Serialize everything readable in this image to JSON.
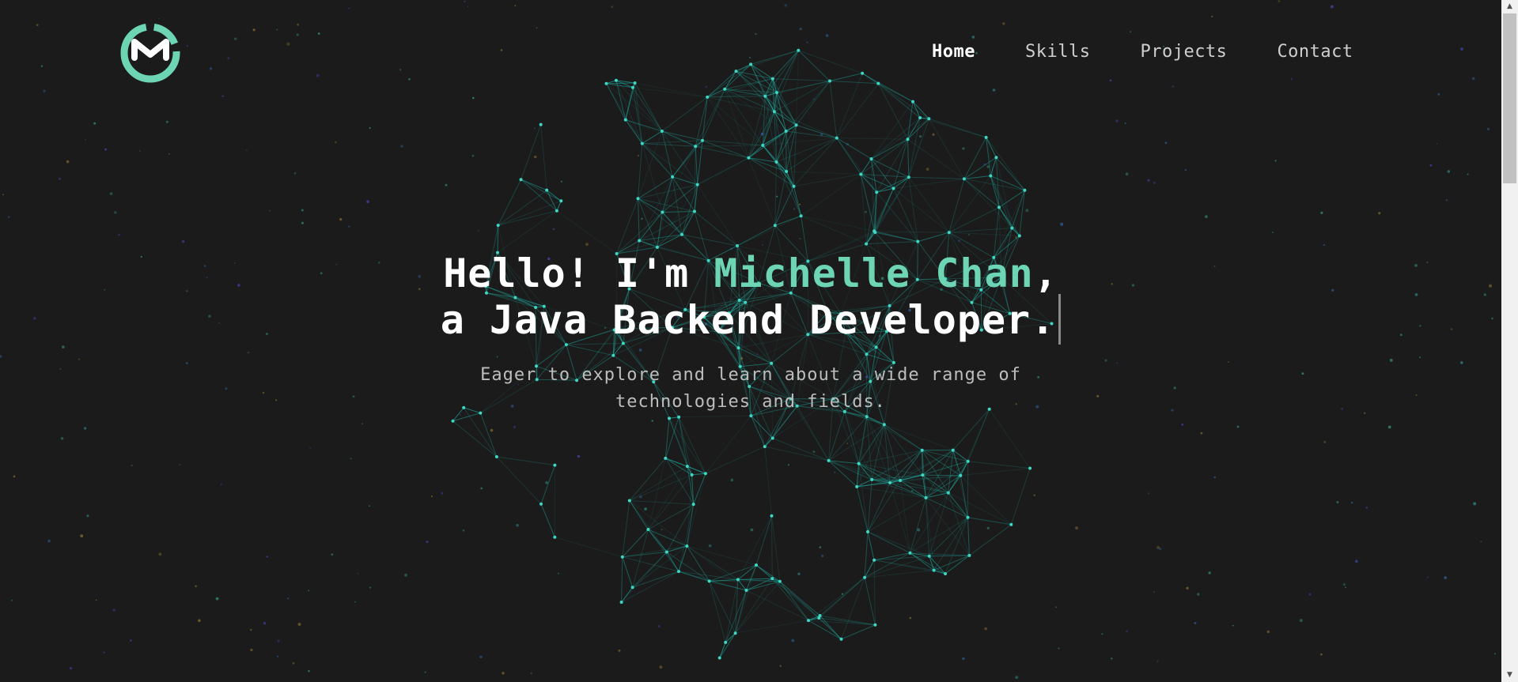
{
  "logo": {
    "icon": "m-circle-logo",
    "color": "#6dd5b4"
  },
  "nav": {
    "items": [
      {
        "label": "Home",
        "active": true
      },
      {
        "label": "Skills",
        "active": false
      },
      {
        "label": "Projects",
        "active": false
      },
      {
        "label": "Contact",
        "active": false
      }
    ]
  },
  "hero": {
    "greeting": "Hello! I'm ",
    "name": "Michelle Chan",
    "comma": ",",
    "role": "a Java Backend Developer.",
    "subtitle": "Eager to explore and learn about a wide range of technologies and fields."
  },
  "colors": {
    "background": "#1b1b1b",
    "accent": "#6dd5b4",
    "network": "#1fb5a8"
  }
}
